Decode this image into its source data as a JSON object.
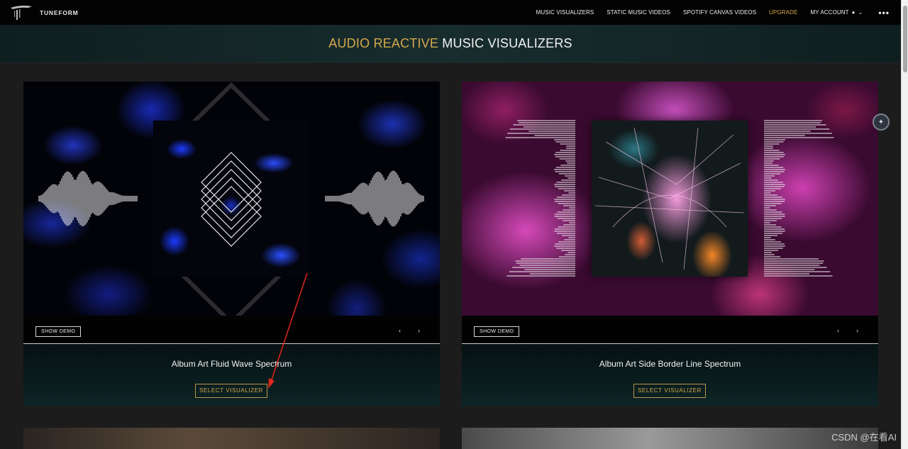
{
  "brand": {
    "name": "TUNEFORM"
  },
  "nav": {
    "items": [
      "MUSIC VISUALIZERS",
      "STATIC MUSIC VIDEOS",
      "SPOTIFY CANVAS VIDEOS",
      "UPGRADE"
    ],
    "account_label": "MY ACCOUNT",
    "more_icon": "ellipsis-icon"
  },
  "hero": {
    "title_accent": "AUDIO REACTIVE",
    "title_rest": "MUSIC VISUALIZERS"
  },
  "cards": [
    {
      "title": "Album Art Fluid Wave Spectrum",
      "demo_label": "SHOW DEMO",
      "prev": "‹",
      "next": "›",
      "select_label": "SELECT VISUALIZER"
    },
    {
      "title": "Album Art Side Border Line Spectrum",
      "demo_label": "SHOW DEMO",
      "prev": "‹",
      "next": "›",
      "select_label": "SELECT VISUALIZER"
    }
  ],
  "colors": {
    "accent": "#d4a84b",
    "nav_bg": "#030303",
    "page_bg": "#1c1c1c",
    "annotation": "#e0251b"
  },
  "watermark": "CSDN @在看AI"
}
